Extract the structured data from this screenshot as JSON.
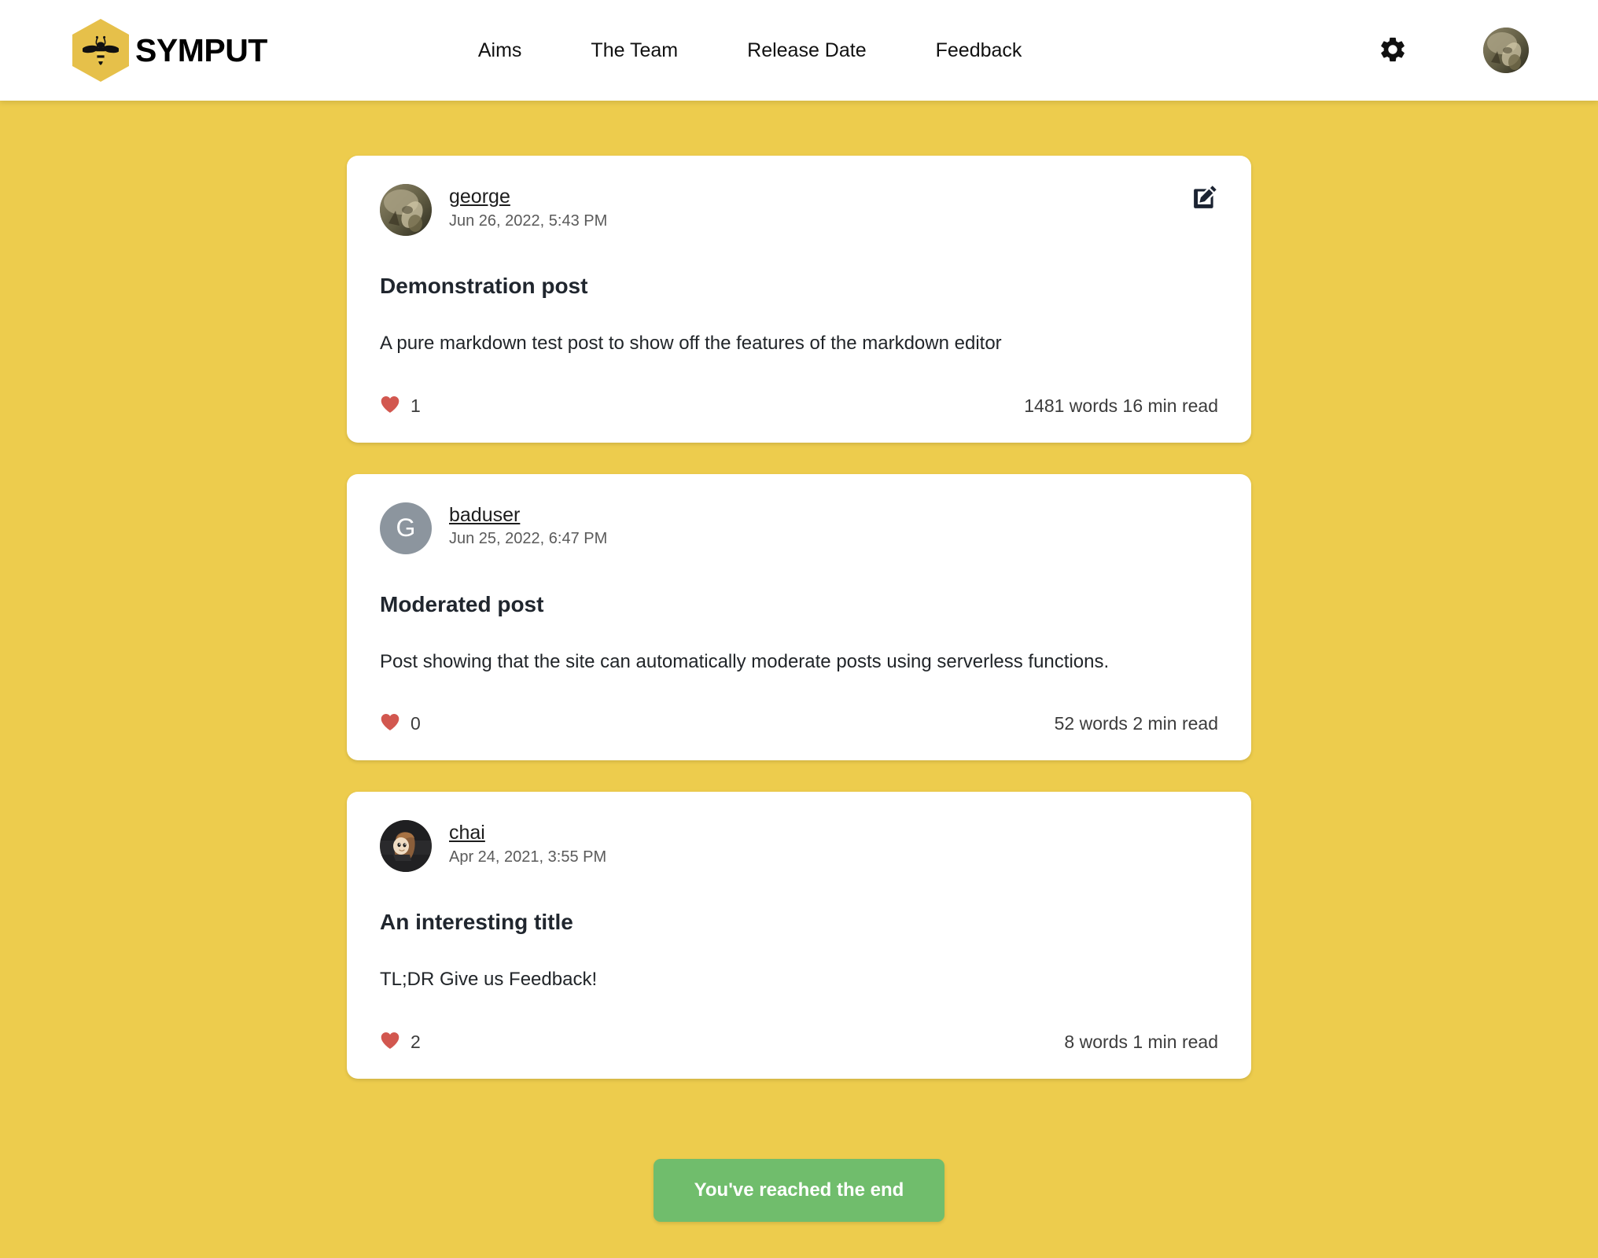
{
  "theme": {
    "page_background": "#edcc4d",
    "header_background": "#ffffff",
    "card_background": "#ffffff",
    "accent_yellow": "#e6c04a",
    "heart_red": "#d2574f",
    "end_button_green": "#70bd6c",
    "initial_avatar_gray": "#8c959e",
    "title_color": "#20262e"
  },
  "header": {
    "brand": {
      "name": "SYMPUT",
      "logo_icon": "bee-hexagon-icon"
    },
    "nav_links": [
      {
        "label": "Aims"
      },
      {
        "label": "The Team"
      },
      {
        "label": "Release Date"
      },
      {
        "label": "Feedback"
      }
    ],
    "settings_icon": "gear-icon",
    "user_avatar": {
      "icon": "avatar",
      "alt": "pangolin photo avatar"
    }
  },
  "feed": {
    "posts": [
      {
        "author": "george",
        "date": "Jun 26, 2022, 5:43 PM",
        "title": "Demonstration post",
        "body": "A pure markdown test post to show off the features of the markdown editor",
        "likes": "1",
        "read_info": "1481 words 16 min read",
        "avatar_type": "image",
        "avatar_alt": "pangolin photo avatar",
        "has_edit_button": true,
        "edit_icon": "pen-to-square-icon"
      },
      {
        "author": "baduser",
        "date": "Jun 25, 2022, 6:47 PM",
        "title": "Moderated post",
        "body": "Post showing that the site can automatically moderate posts using serverless functions.",
        "likes": "0",
        "read_info": "52 words 2 min read",
        "avatar_type": "initial",
        "avatar_initial": "G",
        "has_edit_button": false
      },
      {
        "author": "chai",
        "date": "Apr 24, 2021, 3:55 PM",
        "title": "An interesting title",
        "body": "TL;DR Give us Feedback!",
        "likes": "2",
        "read_info": "8 words 1 min read",
        "avatar_type": "image",
        "avatar_alt": "cartoon character avatar",
        "has_edit_button": false
      }
    ],
    "end_message": "You've reached the end"
  }
}
